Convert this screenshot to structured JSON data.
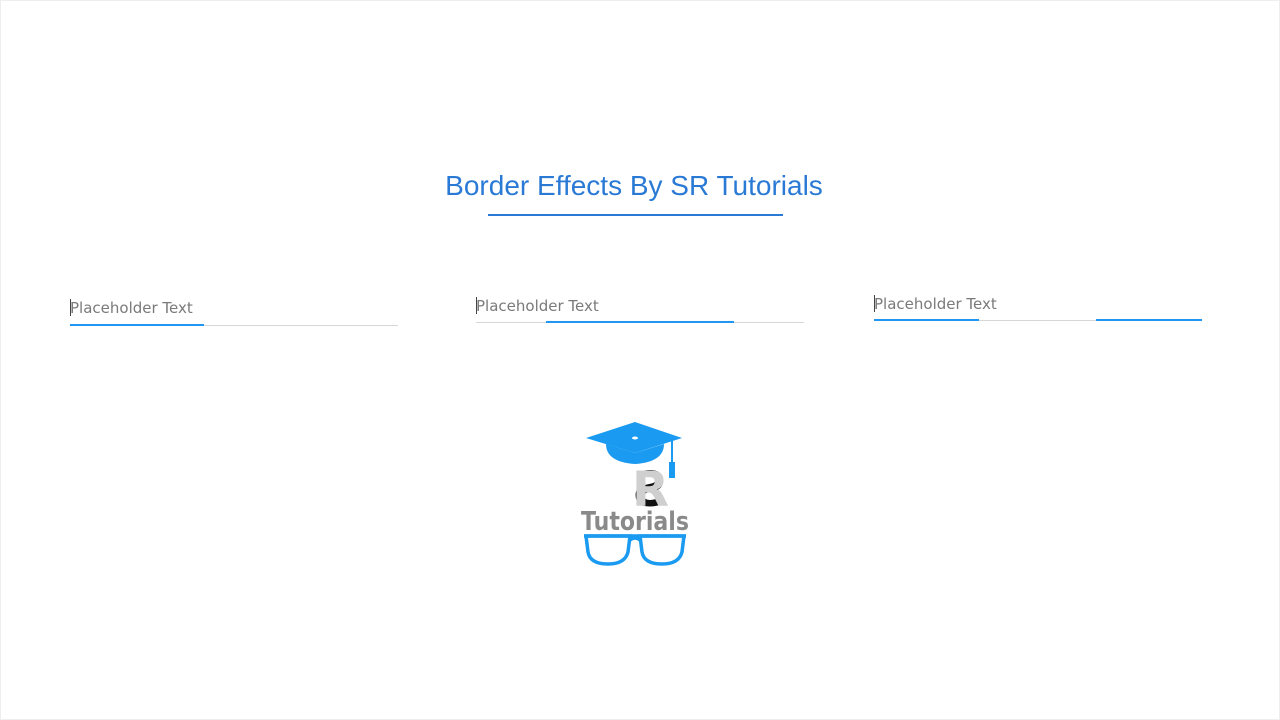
{
  "page": {
    "title": "Border Effects By SR Tutorials"
  },
  "colors": {
    "accent": "#2196F3",
    "title": "#2A7AD5",
    "base_line": "#D7D7D7"
  },
  "fields": [
    {
      "placeholder": "Placeholder Text",
      "value": "",
      "effect_progress": 0.41
    },
    {
      "placeholder": "Placeholder Text",
      "value": "",
      "effect_progress": 0.57
    },
    {
      "placeholder": "Placeholder Text",
      "value": "",
      "effect_progress": 0.64
    }
  ],
  "logo": {
    "text_top": "SR",
    "text_bottom": "Tutorials",
    "icons": [
      "graduation-cap-icon",
      "glasses-icon"
    ]
  }
}
